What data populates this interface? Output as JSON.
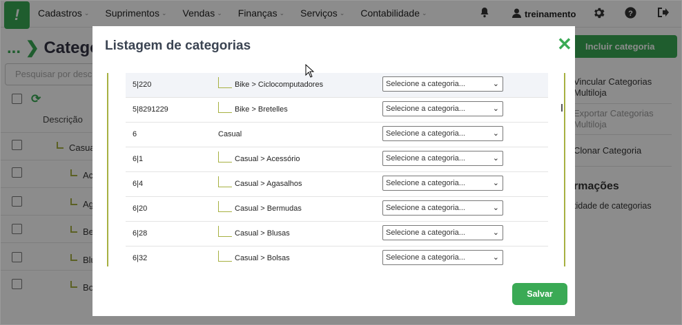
{
  "nav": {
    "menu": [
      "Cadastros",
      "Suprimentos",
      "Vendas",
      "Finanças",
      "Serviços",
      "Contabilidade"
    ],
    "user": "treinamento",
    "icons": [
      "bell-icon",
      "user-icon",
      "gear-icon",
      "help-icon",
      "logout-icon"
    ]
  },
  "page": {
    "breadcrumb_dots": "...",
    "title": "Categor",
    "search_placeholder": "Pesquisar por descri",
    "column_description": "Descrição",
    "rows": [
      "Casual",
      "Ac",
      "Ag",
      "Be",
      "Blu",
      "Bo"
    ],
    "include_button": "Incluir categoria",
    "side_links": [
      "Vincular Categorias Multiloja",
      "Exportar Categorias Multiloja",
      "Clonar Categoria"
    ],
    "info_heading": "rmações",
    "info_sub": "tidade de categorias"
  },
  "modal": {
    "title": "Listagem de categorias",
    "save_button": "Salvar",
    "select_placeholder": "Selecione a categoria...",
    "rows": [
      {
        "code": "5|220",
        "name": "Bike > Ciclocomputadores",
        "child": true
      },
      {
        "code": "5|8291229",
        "name": "Bike > Bretelles",
        "child": true
      },
      {
        "code": "6",
        "name": "Casual",
        "child": false
      },
      {
        "code": "6|1",
        "name": "Casual > Acessório",
        "child": true
      },
      {
        "code": "6|4",
        "name": "Casual > Agasalhos",
        "child": true
      },
      {
        "code": "6|20",
        "name": "Casual > Bermudas",
        "child": true
      },
      {
        "code": "6|28",
        "name": "Casual > Blusas",
        "child": true
      },
      {
        "code": "6|32",
        "name": "Casual > Bolsas",
        "child": true
      }
    ]
  },
  "colors": {
    "accent": "#3aaa55",
    "tree_line": "#a6b040"
  }
}
